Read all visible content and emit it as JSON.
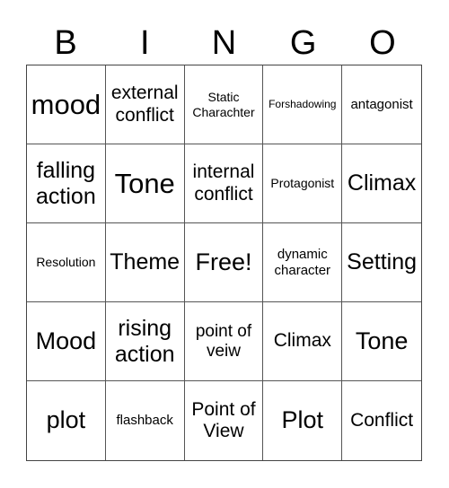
{
  "header": {
    "letters": [
      "B",
      "I",
      "N",
      "G",
      "O"
    ]
  },
  "grid": {
    "cells": [
      "mood",
      "external conflict",
      "Static Charachter",
      "Forshadowing",
      "antagonist",
      "falling action",
      "Tone",
      "internal conflict",
      "Protagonist",
      "Climax",
      "Resolution",
      "Theme",
      "Free!",
      "dynamic character",
      "Setting",
      "Mood",
      "rising action",
      "point of veiw",
      "Climax",
      "Tone",
      "plot",
      "flashback",
      "Point of View",
      "Plot",
      "Conflict"
    ]
  }
}
